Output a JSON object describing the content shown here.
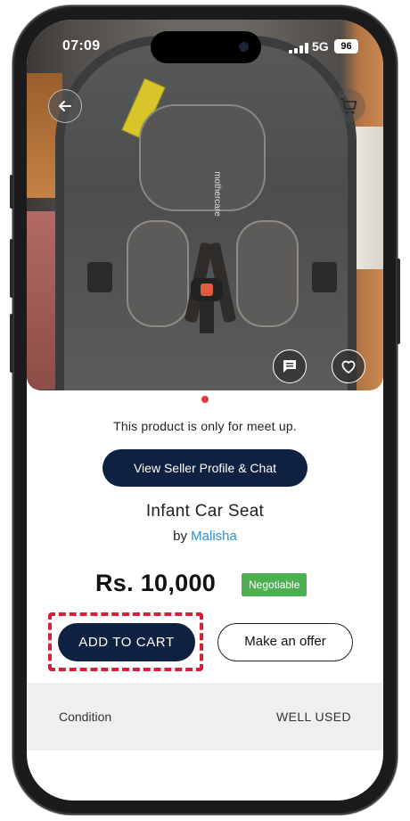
{
  "status_bar": {
    "time": "07:09",
    "network": "5G",
    "battery": "96"
  },
  "hero": {
    "back_icon": "arrow-left-icon",
    "cart_icon": "shopping-cart-icon",
    "chat_icon": "message-icon",
    "favorite_icon": "heart-icon",
    "brand_text": "mothercare"
  },
  "product": {
    "meetup_notice": "This product is only for meet up.",
    "seller_button_label": "View Seller Profile & Chat",
    "title": "Infant Car Seat",
    "by_prefix": "by",
    "seller_name": "Malisha",
    "price": "Rs. 10,000",
    "negotiable_badge": "Negotiable"
  },
  "actions": {
    "add_to_cart_label": "ADD TO CART",
    "make_offer_label": "Make an offer"
  },
  "details": {
    "condition_label": "Condition",
    "condition_value": "WELL USED"
  },
  "colors": {
    "primary": "#0e2140",
    "link": "#2d8fd5",
    "badge": "#4caf50",
    "highlight": "#d41f3d"
  }
}
